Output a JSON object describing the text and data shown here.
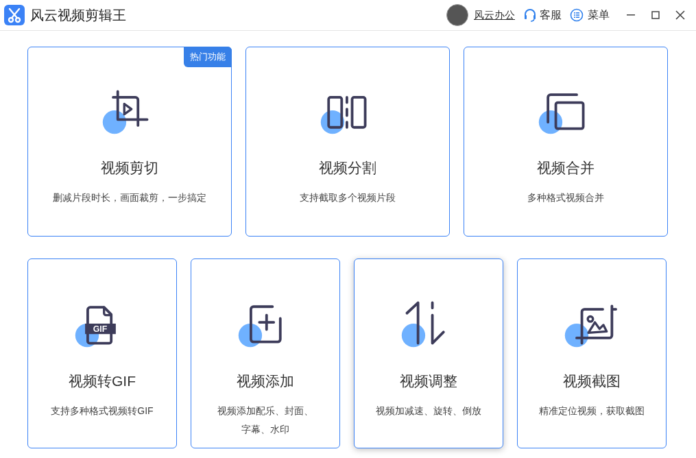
{
  "app": {
    "title": "风云视频剪辑王"
  },
  "header": {
    "user": "风云办公",
    "service": "客服",
    "menu": "菜单"
  },
  "cards": [
    {
      "kind": "crop",
      "title": "视频剪切",
      "description": "删减片段时长，画面裁剪，一步搞定",
      "badge": "热门功能",
      "hovered": false
    },
    {
      "kind": "split",
      "title": "视频分割",
      "description": "支持截取多个视频片段",
      "hovered": false
    },
    {
      "kind": "merge",
      "title": "视频合并",
      "description": "多种格式视频合并",
      "hovered": false
    },
    {
      "kind": "gif",
      "title": "视频转GIF",
      "description": "支持多种格式视频转GIF",
      "icon_text": "GIF",
      "hovered": false
    },
    {
      "kind": "add",
      "title": "视频添加",
      "description": "视频添加配乐、封面、字幕、水印",
      "hovered": false
    },
    {
      "kind": "adjust",
      "title": "视频调整",
      "description": "视频加减速、旋转、倒放",
      "hovered": true
    },
    {
      "kind": "snapshot",
      "title": "视频截图",
      "description": "精准定位视频，获取截图",
      "hovered": false
    }
  ]
}
